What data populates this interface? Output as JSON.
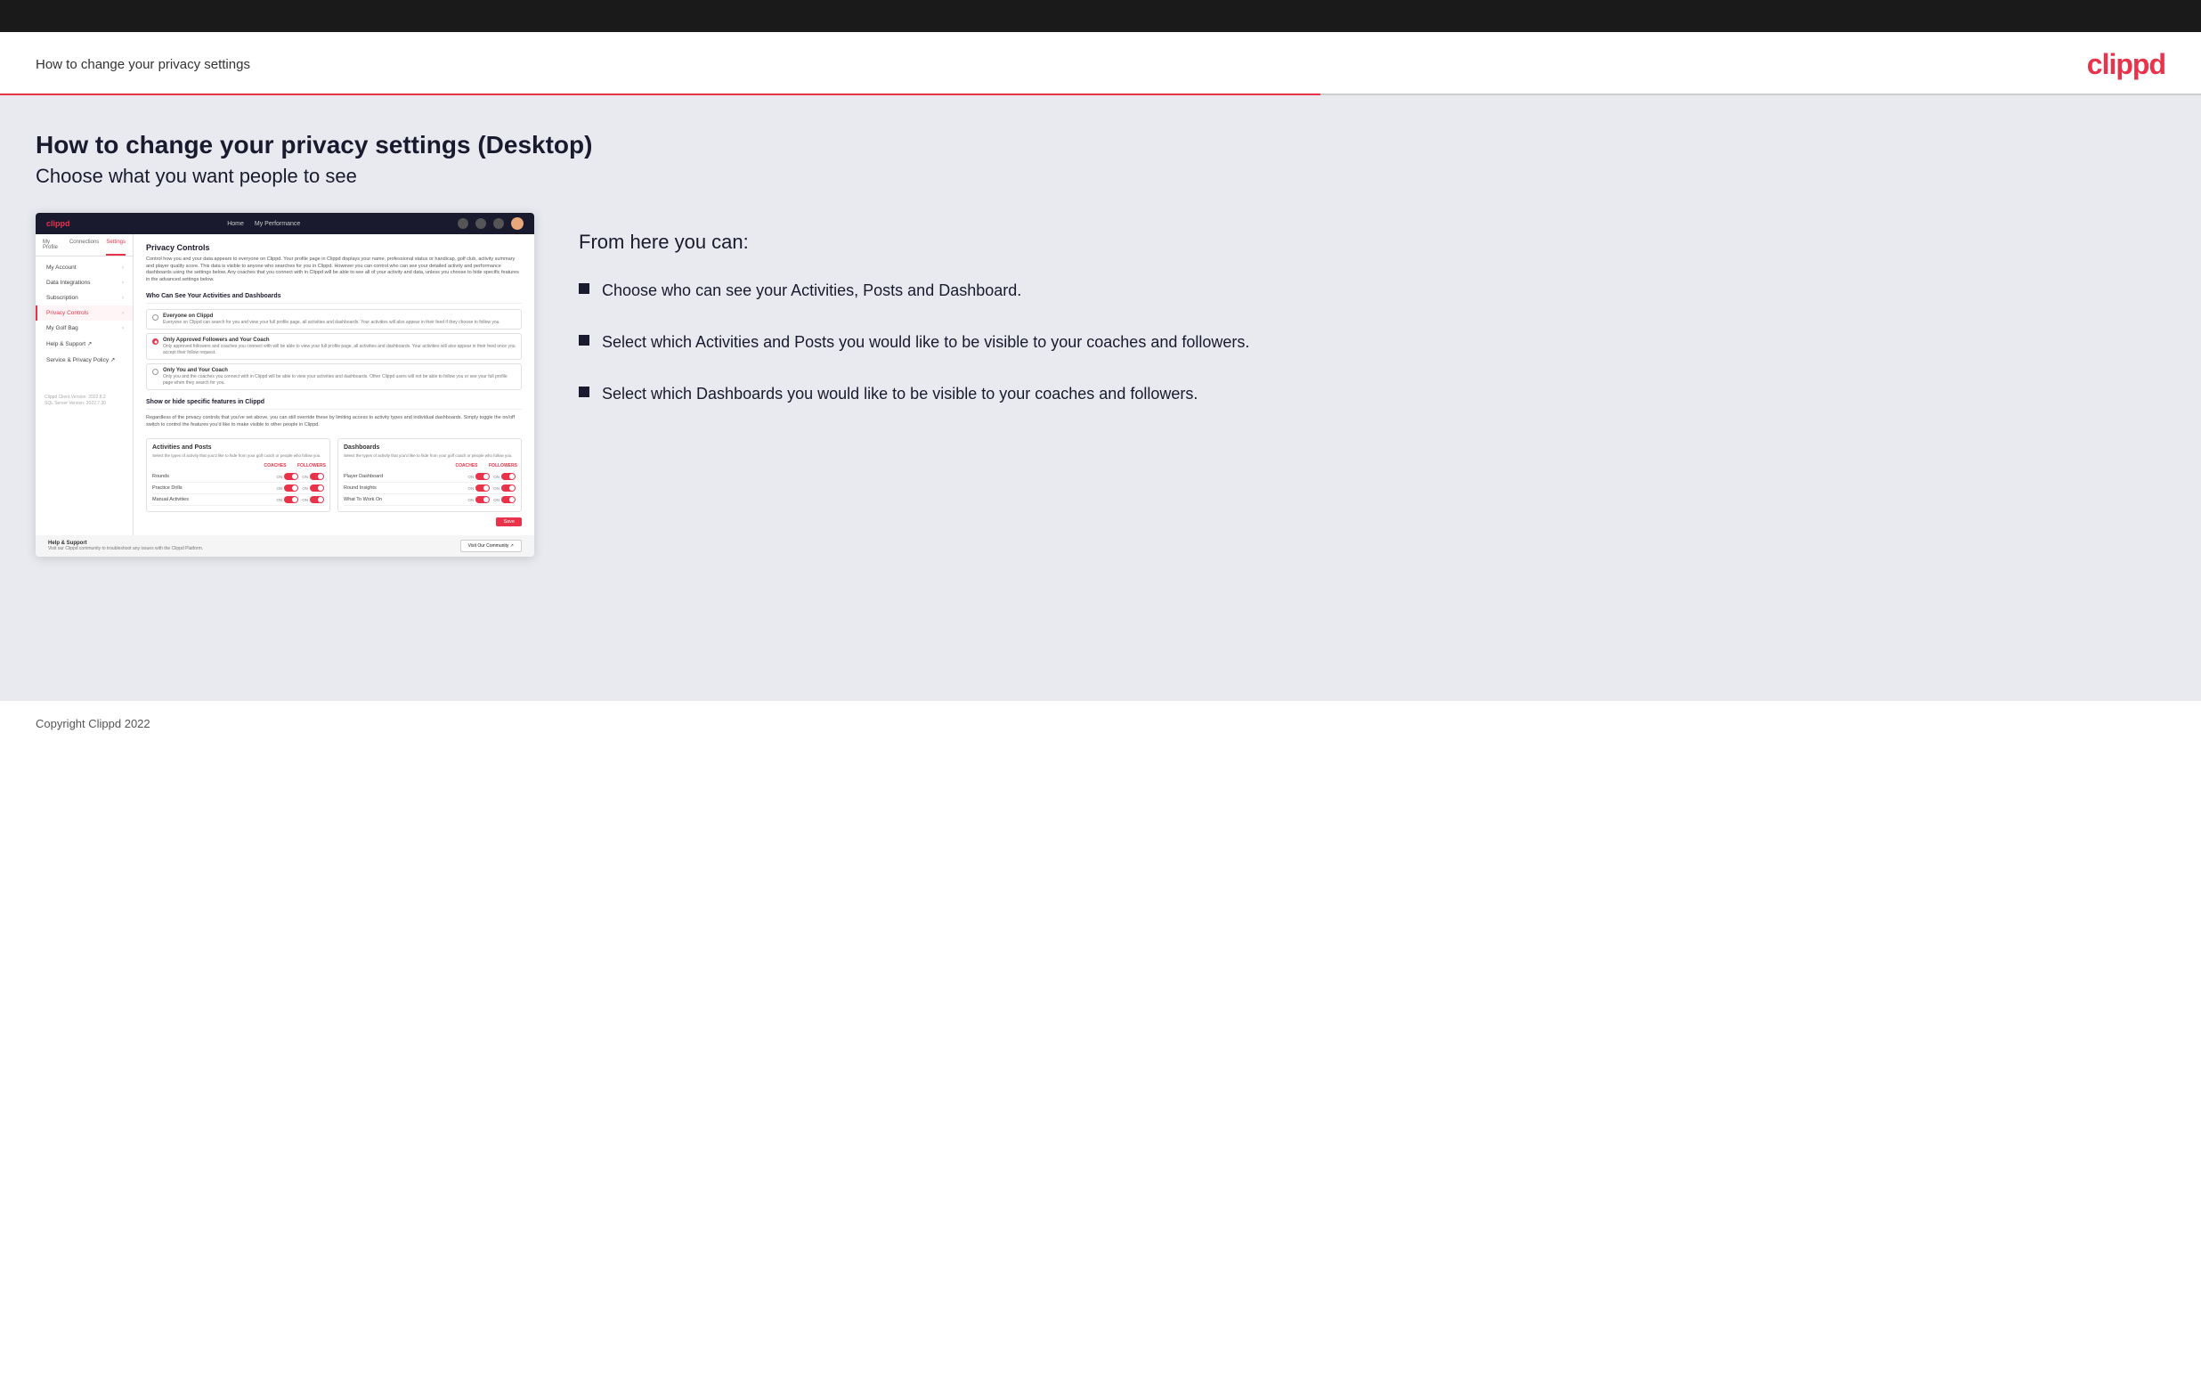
{
  "topbar": {},
  "header": {
    "title": "How to change your privacy settings",
    "logo": "clippd"
  },
  "main": {
    "title": "How to change your privacy settings (Desktop)",
    "subtitle": "Choose what you want people to see",
    "from_here": "From here you can:",
    "bullets": [
      {
        "text": "Choose who can see your Activities, Posts and Dashboard."
      },
      {
        "text": "Select which Activities and Posts you would like to be visible to your coaches and followers."
      },
      {
        "text": "Select which Dashboards you would like to be visible to your coaches and followers."
      }
    ]
  },
  "mockup": {
    "nav": {
      "logo": "clippd",
      "links": [
        "Home",
        "My Performance"
      ],
      "icons": [
        "search",
        "grid",
        "settings",
        "avatar"
      ]
    },
    "tabs": [
      "My Profile",
      "Connections",
      "Settings"
    ],
    "active_tab": "Settings",
    "sidebar_items": [
      {
        "label": "My Account",
        "active": false
      },
      {
        "label": "Data Integrations",
        "active": false
      },
      {
        "label": "Subscription",
        "active": false
      },
      {
        "label": "Privacy Controls",
        "active": true
      },
      {
        "label": "My Golf Bag",
        "active": false
      },
      {
        "label": "Help & Support ↗",
        "active": false
      },
      {
        "label": "Service & Privacy Policy ↗",
        "active": false
      }
    ],
    "version": "Clippd Client Version: 2022.8.2\nSQL Server Version: 2022.7.30",
    "privacy_controls": {
      "section_title": "Privacy Controls",
      "section_desc": "Control how you and your data appears to everyone on Clippd. Your profile page in Clippd displays your name, professional status or handicap, golf club, activity summary and player quality score. This data is visible to anyone who searches for you in Clippd. However you can control who can see your detailed activity and performance dashboards using the settings below. Any coaches that you connect with in Clippd will be able to see all of your activity and data, unless you choose to hide specific features in the advanced settings below.",
      "subsection_title": "Who Can See Your Activities and Dashboards",
      "options": [
        {
          "label": "Everyone on Clippd",
          "desc": "Everyone on Clippd can search for you and view your full profile page, all activities and dashboards. Your activities will also appear in their feed if they choose to follow you.",
          "selected": false
        },
        {
          "label": "Only Approved Followers and Your Coach",
          "desc": "Only approved followers and coaches you connect with will be able to view your full profile page, all activities and dashboards. Your activities will also appear in their feed once you accept their follow request.",
          "selected": true
        },
        {
          "label": "Only You and Your Coach",
          "desc": "Only you and the coaches you connect with in Clippd will be able to view your activities and dashboards. Other Clippd users will not be able to follow you or see your full profile page when they search for you.",
          "selected": false
        }
      ],
      "show_hide_title": "Show or hide specific features in Clippd",
      "show_hide_desc": "Regardless of the privacy controls that you've set above, you can still override these by limiting access to activity types and individual dashboards. Simply toggle the on/off switch to control the features you'd like to make visible to other people in Clippd.",
      "activities_panel": {
        "title": "Activities and Posts",
        "desc": "Select the types of activity that you'd like to hide from your golf coach or people who follow you.",
        "cols": [
          "COACHES",
          "FOLLOWERS"
        ],
        "rows": [
          {
            "label": "Rounds",
            "coaches_on": true,
            "followers_on": true
          },
          {
            "label": "Practice Drills",
            "coaches_on": true,
            "followers_on": true
          },
          {
            "label": "Manual Activities",
            "coaches_on": true,
            "followers_on": true
          }
        ]
      },
      "dashboards_panel": {
        "title": "Dashboards",
        "desc": "Select the types of activity that you'd like to hide from your golf coach or people who follow you.",
        "cols": [
          "COACHES",
          "FOLLOWERS"
        ],
        "rows": [
          {
            "label": "Player Dashboard",
            "coaches_on": true,
            "followers_on": true
          },
          {
            "label": "Round Insights",
            "coaches_on": true,
            "followers_on": true
          },
          {
            "label": "What To Work On",
            "coaches_on": true,
            "followers_on": true
          }
        ]
      },
      "save_label": "Save"
    },
    "help": {
      "title": "Help & Support",
      "desc": "Visit our Clippd community to troubleshoot any issues with the Clippd Platform.",
      "btn_label": "Visit Our Community ↗"
    }
  },
  "footer": {
    "text": "Copyright Clippd 2022"
  }
}
